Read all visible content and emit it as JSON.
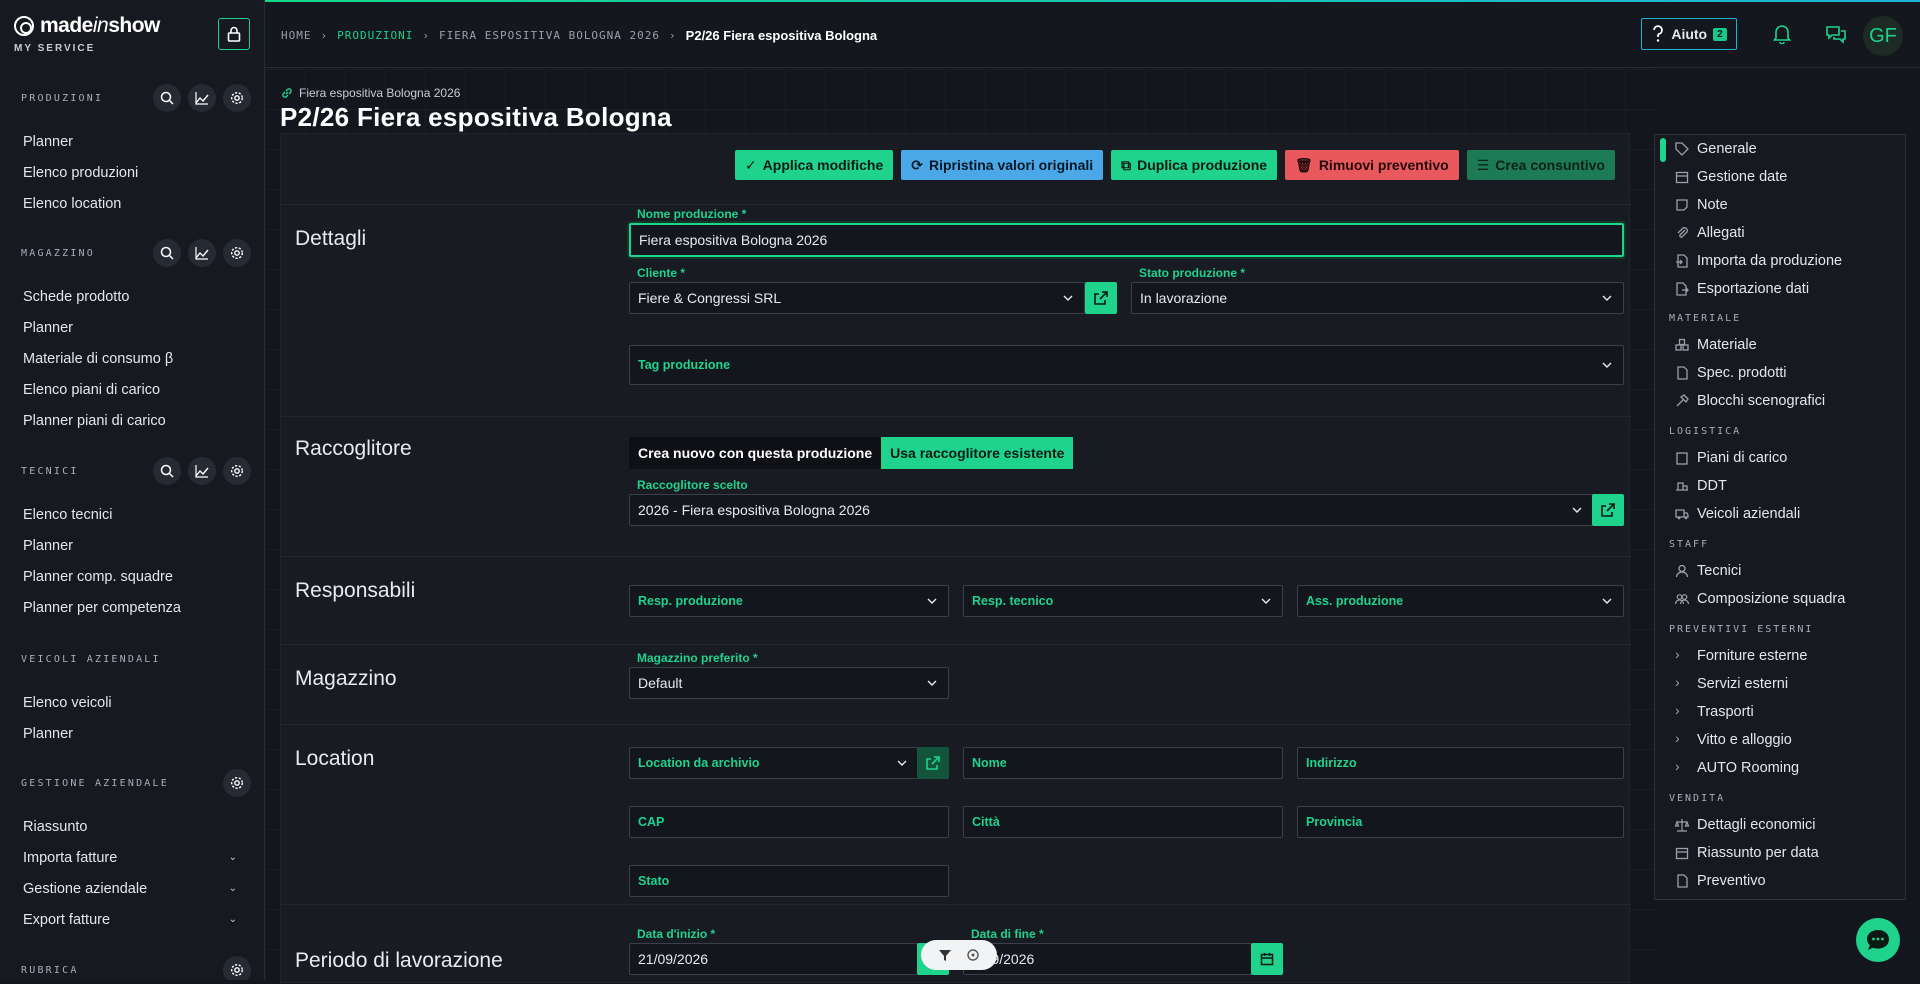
{
  "brand": {
    "name_prefix": "made",
    "name_italic": "in",
    "name_suffix": "show",
    "service": "MY SERVICE"
  },
  "sidebar": {
    "sections": [
      {
        "title": "PRODUZIONI",
        "items": [
          "Planner",
          "Elenco produzioni",
          "Elenco location"
        ]
      },
      {
        "title": "MAGAZZINO",
        "items": [
          "Schede prodotto",
          "Planner",
          "Materiale di consumo β",
          "Elenco piani di carico",
          "Planner piani di carico"
        ]
      },
      {
        "title": "TECNICI",
        "items": [
          "Elenco tecnici",
          "Planner",
          "Planner comp. squadre",
          "Planner per competenza"
        ]
      },
      {
        "title": "VEICOLI AZIENDALI",
        "items": [
          "Elenco veicoli",
          "Planner"
        ]
      },
      {
        "title": "GESTIONE AZIENDALE",
        "items": [
          "Riassunto",
          "Importa fatture",
          "Gestione aziendale",
          "Export fatture"
        ]
      },
      {
        "title": "RUBRICA",
        "items": []
      }
    ]
  },
  "header": {
    "breadcrumb": [
      "HOME",
      "PRODUZIONI",
      "FIERA ESPOSITIVA BOLOGNA 2026",
      "P2/26 Fiera espositiva Bologna"
    ],
    "help_label": "Aiuto",
    "help_count": "2",
    "avatar_initials": "GF"
  },
  "page": {
    "subtitle": "Fiera espositiva Bologna 2026",
    "title": "P2/26 Fiera espositiva Bologna",
    "actions": {
      "apply": "Applica modifiche",
      "restore": "Ripristina valori originali",
      "duplicate": "Duplica produzione",
      "remove": "Rimuovi preventivo",
      "create": "Crea consuntivo"
    }
  },
  "form": {
    "dettagli": {
      "section": "Dettagli",
      "nome_label": "Nome produzione *",
      "nome_value": "Fiera espositiva Bologna 2026",
      "cliente_label": "Cliente *",
      "cliente_value": "Fiere & Congressi SRL",
      "stato_label": "Stato produzione *",
      "stato_value": "In lavorazione",
      "tag_placeholder": "Tag produzione"
    },
    "raccoglitore": {
      "section": "Raccoglitore",
      "opt_new": "Crea nuovo con questa produzione",
      "opt_existing": "Usa raccoglitore esistente",
      "scelto_label": "Raccoglitore scelto",
      "scelto_value": "2026 - Fiera espositiva Bologna 2026"
    },
    "responsabili": {
      "section": "Responsabili",
      "resp_prod": "Resp. produzione",
      "resp_tec": "Resp. tecnico",
      "ass_prod": "Ass. produzione"
    },
    "magazzino": {
      "section": "Magazzino",
      "label": "Magazzino preferito *",
      "value": "Default"
    },
    "location": {
      "section": "Location",
      "archivio": "Location da archivio",
      "nome": "Nome",
      "indirizzo": "Indirizzo",
      "cap": "CAP",
      "citta": "Città",
      "provincia": "Provincia",
      "stato": "Stato"
    },
    "periodo": {
      "section": "Periodo di lavorazione",
      "inizio_label": "Data d'inizio *",
      "inizio_value": "21/09/2026",
      "fine_label": "Data di fine *",
      "fine_value": "...09/2026"
    }
  },
  "right_panel": {
    "items_top": [
      "Generale",
      "Gestione date",
      "Note",
      "Allegati",
      "Importa da produzione",
      "Esportazione dati"
    ],
    "materiale_head": "MATERIALE",
    "materiale": [
      "Materiale",
      "Spec. prodotti",
      "Blocchi scenografici"
    ],
    "logistica_head": "LOGISTICA",
    "logistica": [
      "Piani di carico",
      "DDT",
      "Veicoli aziendali"
    ],
    "staff_head": "STAFF",
    "staff": [
      "Tecnici",
      "Composizione squadra"
    ],
    "preventivi_head": "PREVENTIVI ESTERNI",
    "preventivi": [
      "Forniture esterne",
      "Servizi esterni",
      "Trasporti",
      "Vitto e alloggio",
      "AUTO Rooming"
    ],
    "vendita_head": "VENDITA",
    "vendita": [
      "Dettagli economici",
      "Riassunto per data",
      "Preventivo"
    ]
  },
  "colors": {
    "accent": "#1fd38d",
    "blue": "#4aa7e8",
    "red": "#e8585c",
    "bg": "#13161d"
  }
}
